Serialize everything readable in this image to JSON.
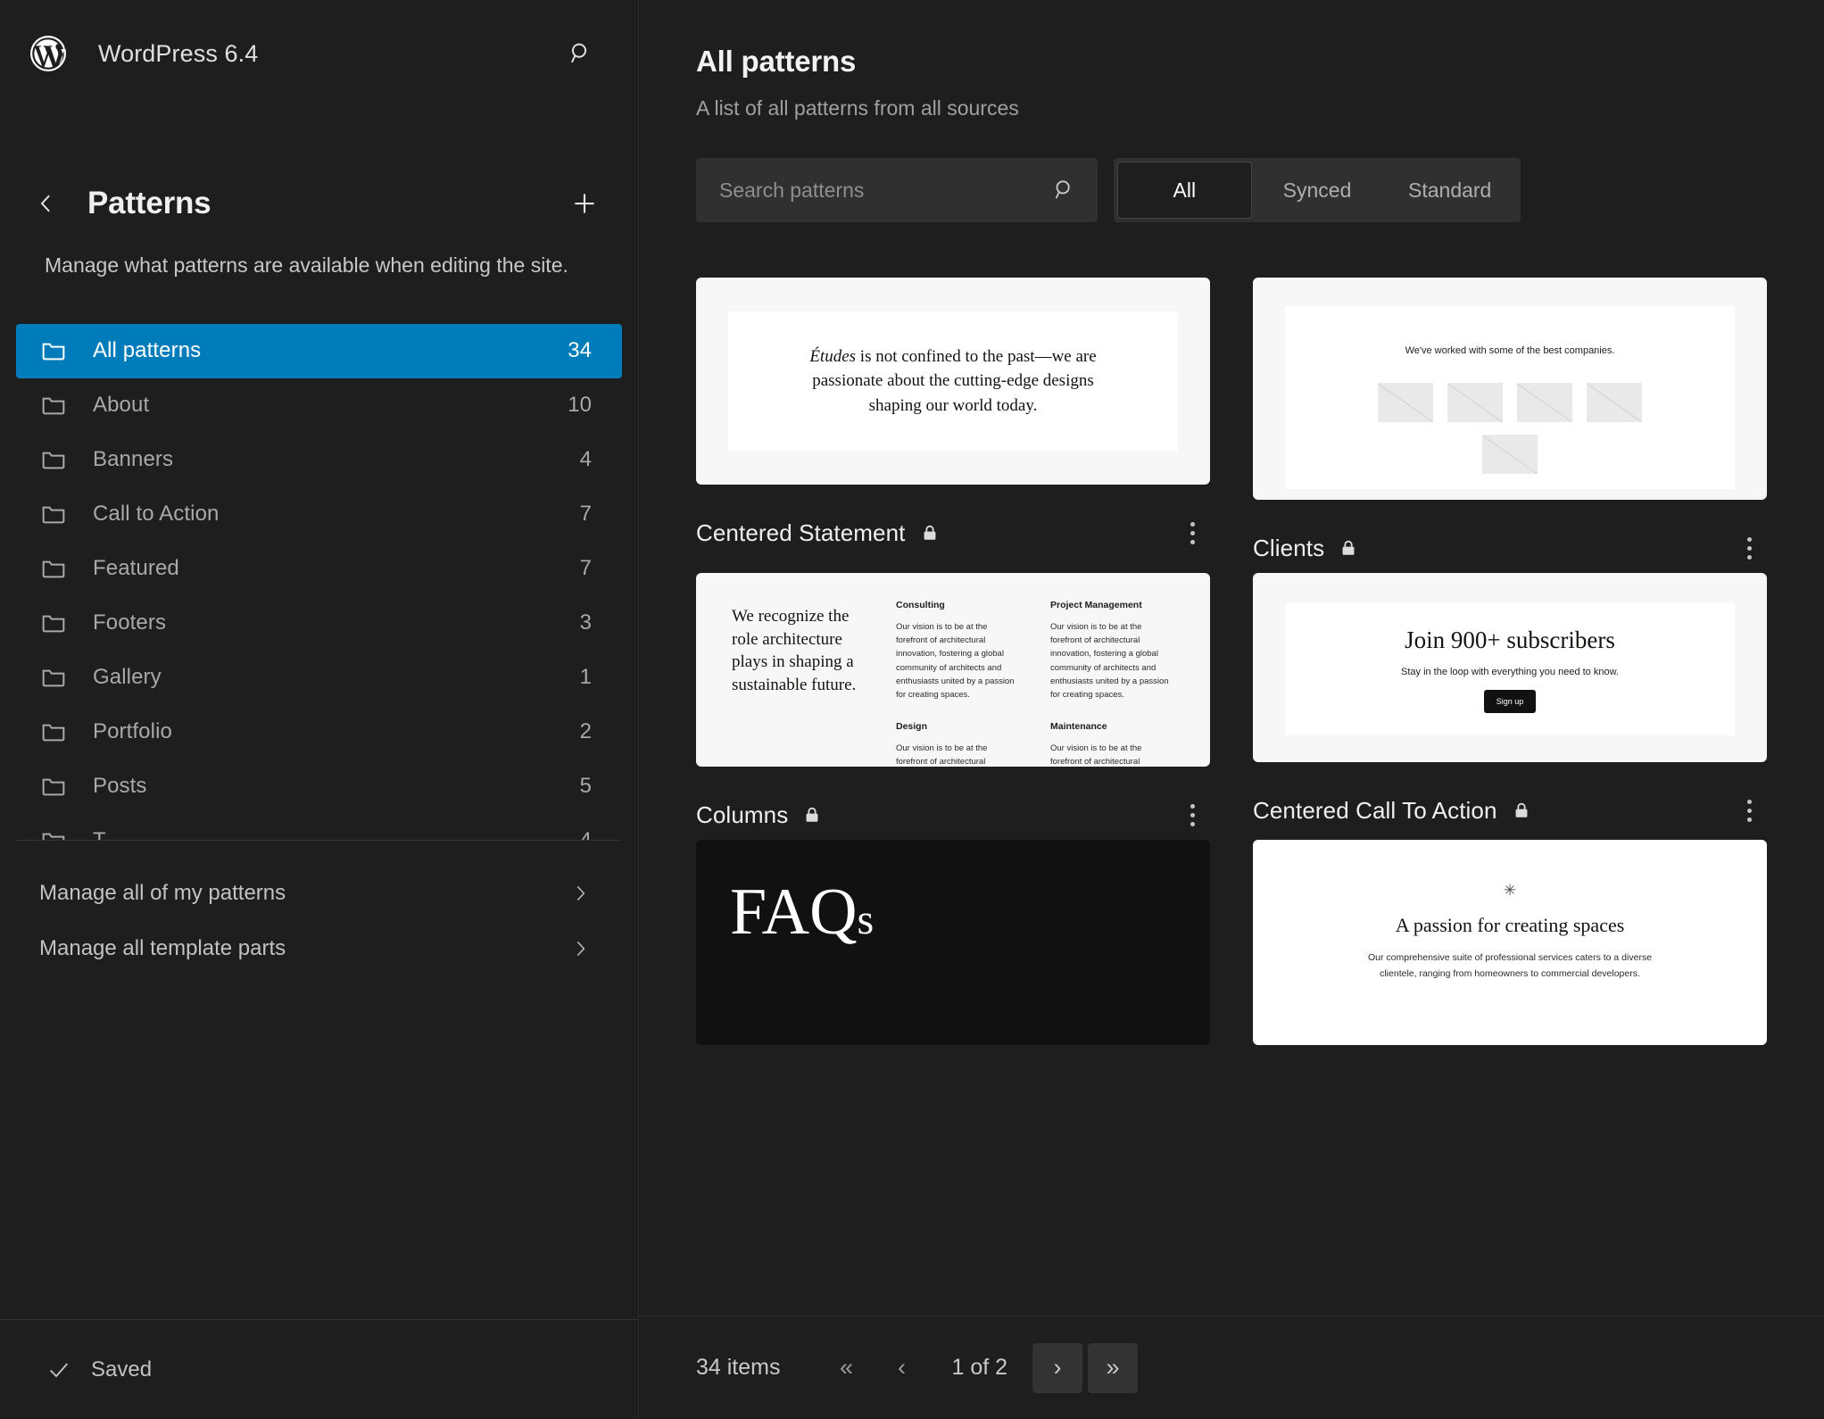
{
  "sidebar": {
    "brand": "WordPress 6.4",
    "brand_icon": "wordpress-logo",
    "search_icon": "search-icon",
    "back_icon": "chevron-left-icon",
    "add_icon": "plus-icon",
    "panel_title": "Patterns",
    "description": "Manage what patterns are available when editing the site.",
    "categories": [
      {
        "label": "All patterns",
        "count": "34",
        "active": true
      },
      {
        "label": "About",
        "count": "10",
        "active": false
      },
      {
        "label": "Banners",
        "count": "4",
        "active": false
      },
      {
        "label": "Call to Action",
        "count": "7",
        "active": false
      },
      {
        "label": "Featured",
        "count": "7",
        "active": false
      },
      {
        "label": "Footers",
        "count": "3",
        "active": false
      },
      {
        "label": "Gallery",
        "count": "1",
        "active": false
      },
      {
        "label": "Portfolio",
        "count": "2",
        "active": false
      },
      {
        "label": "Posts",
        "count": "5",
        "active": false
      }
    ],
    "links": [
      {
        "label": "Manage all of my patterns"
      },
      {
        "label": "Manage all template parts"
      }
    ],
    "footer": {
      "status": "Saved",
      "status_icon": "check-icon"
    }
  },
  "main": {
    "title": "All patterns",
    "subtitle": "A list of all patterns from all sources",
    "search": {
      "placeholder": "Search patterns",
      "value": "",
      "icon": "search-icon"
    },
    "segments": [
      {
        "label": "All",
        "active": true
      },
      {
        "label": "Synced",
        "active": false
      },
      {
        "label": "Standard",
        "active": false
      }
    ],
    "cards": [
      {
        "title": "Centered Statement",
        "locked": true,
        "lock_icon": "lock-icon",
        "menu_icon": "kebab-menu-icon"
      },
      {
        "title": "Clients",
        "locked": true,
        "lock_icon": "lock-icon",
        "menu_icon": "kebab-menu-icon"
      },
      {
        "title": "Columns",
        "locked": true,
        "lock_icon": "lock-icon",
        "menu_icon": "kebab-menu-icon"
      },
      {
        "title": "Centered Call To Action",
        "locked": true,
        "lock_icon": "lock-icon",
        "menu_icon": "kebab-menu-icon"
      }
    ],
    "previews": {
      "centered_statement": {
        "emphasis": "Études",
        "text": " is not confined to the past—we are passionate about the cutting-edge designs shaping our world today."
      },
      "clients": {
        "lead": "We've worked with some of the best companies."
      },
      "columns": {
        "lead": "We recognize the role architecture plays in shaping a sustainable future.",
        "body": "Our vision is to be at the forefront of architectural innovation, fostering a global community of architects and enthusiasts united by a passion for creating spaces.",
        "services": [
          "Consulting",
          "Project Management",
          "Design",
          "Maintenance"
        ]
      },
      "cta": {
        "heading": "Join 900+ subscribers",
        "sub": "Stay in the loop with everything you need to know.",
        "button": "Sign up"
      },
      "faqs": {
        "heading": "FAQ",
        "heading_tail": "s"
      },
      "passion": {
        "ornament": "✳",
        "heading": "A passion for creating spaces",
        "body": "Our comprehensive suite of professional services caters to a diverse clientele, ranging from homeowners to commercial developers."
      }
    },
    "pagination": {
      "count_label": "34 items",
      "first": "«",
      "prev": "‹",
      "position": "1 of 2",
      "next": "›",
      "last": "»"
    }
  },
  "colors": {
    "accent": "#007cba",
    "background": "#1e1e1e",
    "card": "#f7f7f7"
  }
}
